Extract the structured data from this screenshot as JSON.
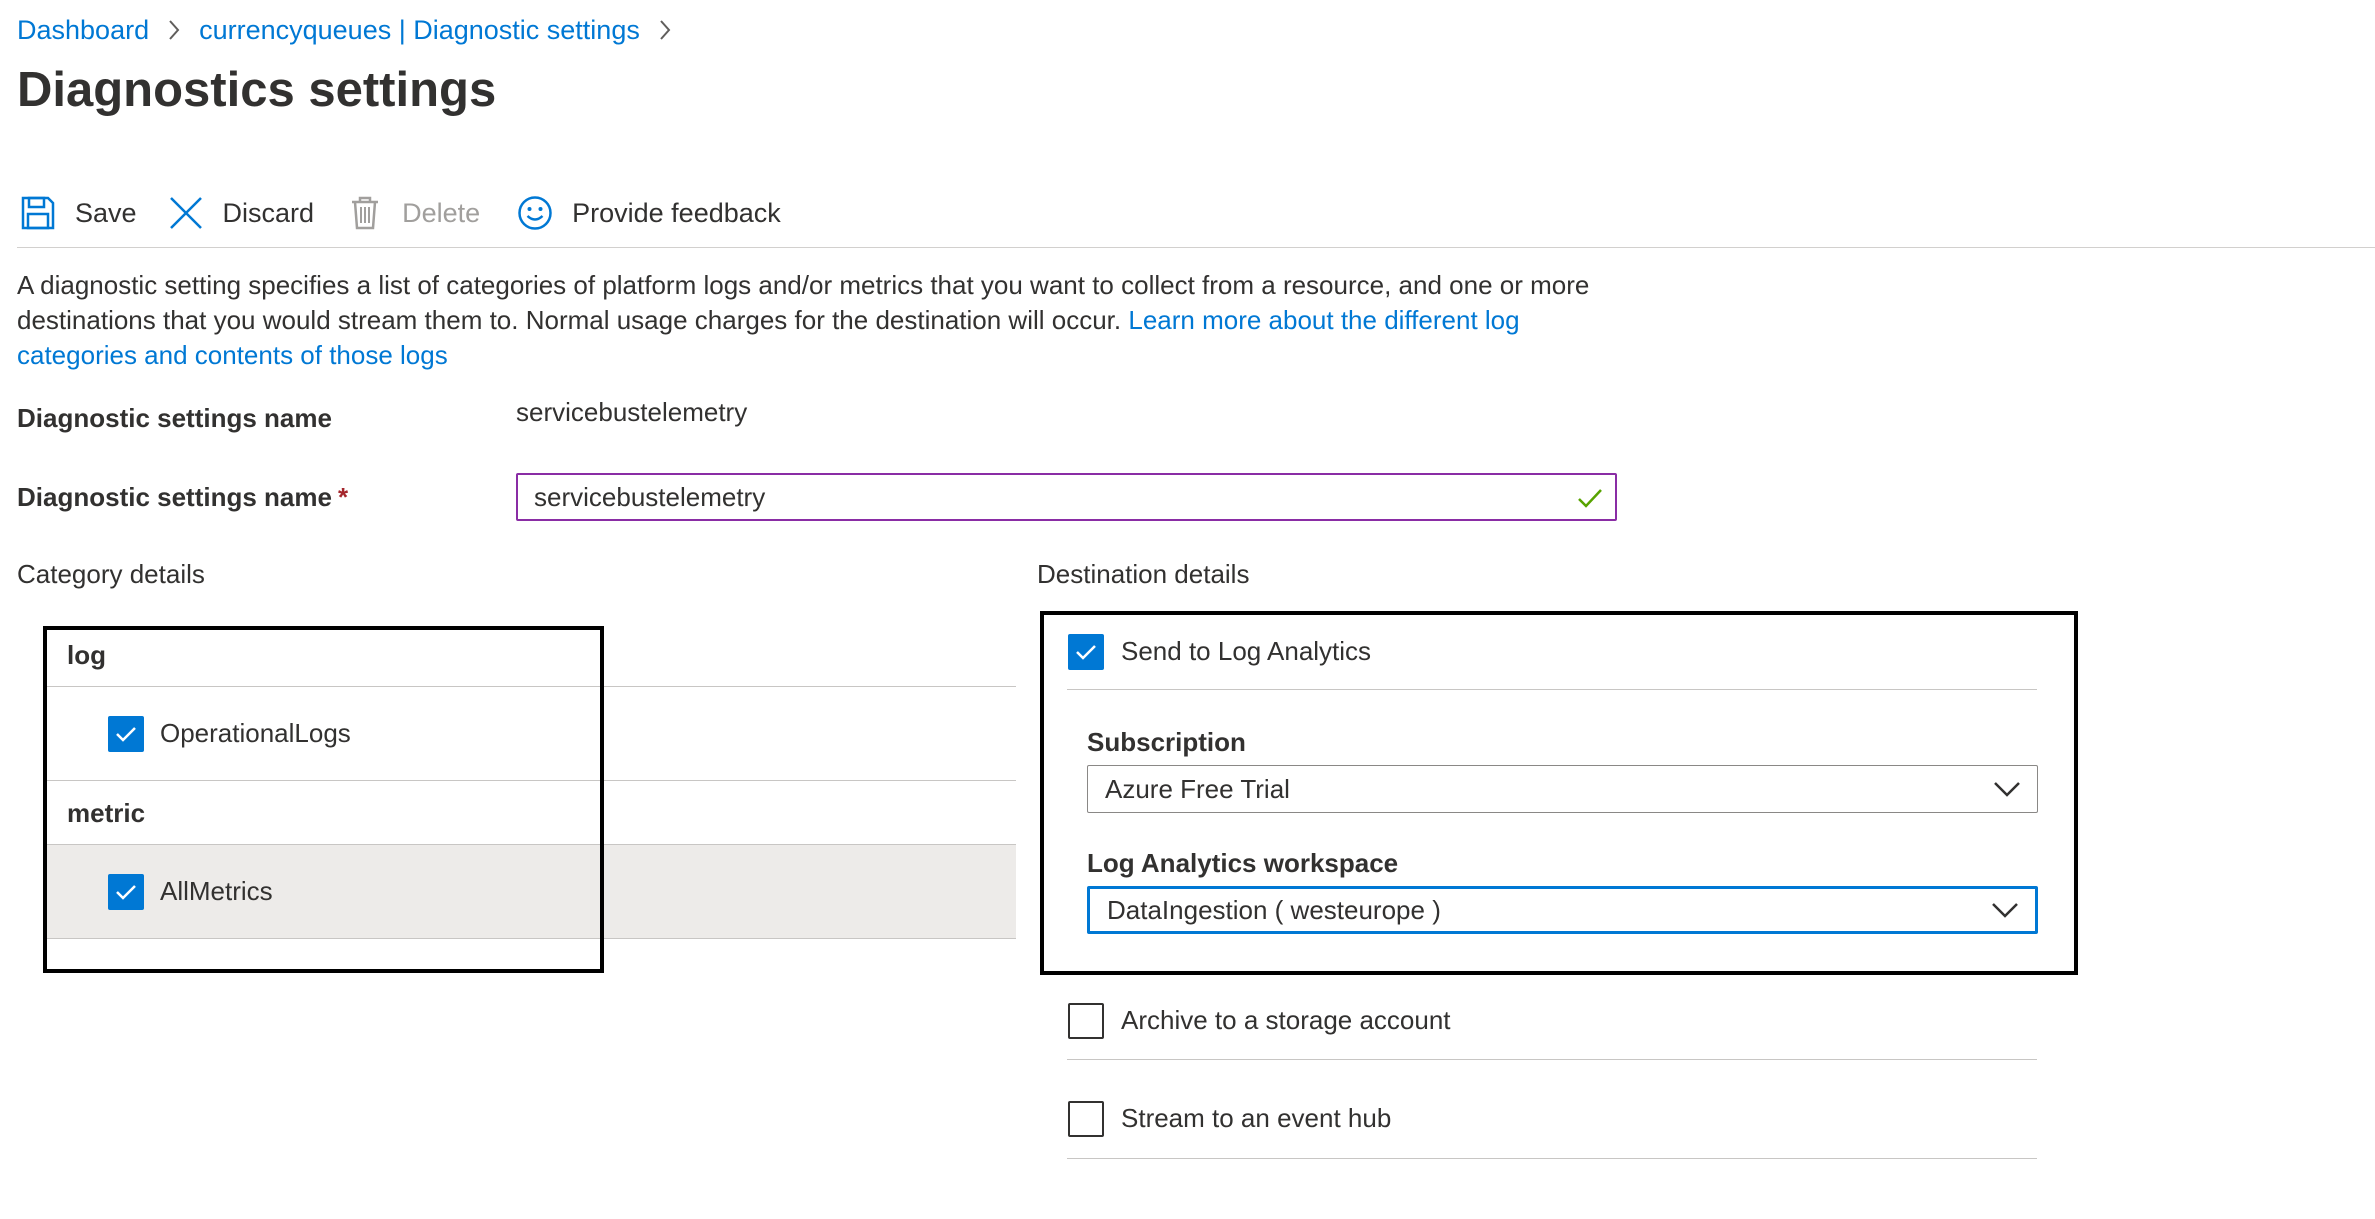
{
  "breadcrumb": {
    "items": [
      "Dashboard",
      "currencyqueues | Diagnostic settings"
    ]
  },
  "page": {
    "title": "Diagnostics settings"
  },
  "toolbar": {
    "save": "Save",
    "discard": "Discard",
    "delete": "Delete",
    "feedback": "Provide feedback"
  },
  "description": {
    "text": "A diagnostic setting specifies a list of categories of platform logs and/or metrics that you want to collect from a resource, and one or more destinations that you would stream them to. Normal usage charges for the destination will occur. ",
    "link": "Learn more about the different log categories and contents of those logs"
  },
  "settings": {
    "name_label": "Diagnostic settings name",
    "name_static_value": "servicebustelemetry",
    "name_input_label": "Diagnostic settings name",
    "required_marker": "*",
    "name_input_value": "servicebustelemetry"
  },
  "category": {
    "heading": "Category details",
    "groups": [
      {
        "name": "log",
        "items": [
          {
            "label": "OperationalLogs",
            "checked": true
          }
        ]
      },
      {
        "name": "metric",
        "items": [
          {
            "label": "AllMetrics",
            "checked": true
          }
        ]
      }
    ]
  },
  "destination": {
    "heading": "Destination details",
    "log_analytics": {
      "label": "Send to Log Analytics",
      "checked": true
    },
    "subscription": {
      "label": "Subscription",
      "value": "Azure Free Trial"
    },
    "workspace": {
      "label": "Log Analytics workspace",
      "value": "DataIngestion ( westeurope )"
    },
    "archive": {
      "label": "Archive to a storage account",
      "checked": false
    },
    "event_hub": {
      "label": "Stream to an event hub",
      "checked": false
    }
  },
  "colors": {
    "accent": "#0078d4",
    "input_border": "#8a2da5",
    "valid_check": "#57a300",
    "required": "#a4262c",
    "row_highlight": "#edebe9"
  },
  "icons": {
    "save": "save-icon",
    "discard": "close-icon",
    "delete": "trash-icon",
    "feedback": "smiley-icon",
    "chevron": "chevron-down-icon",
    "breadcrumb_separator": "chevron-right-icon",
    "valid": "checkmark-icon"
  }
}
